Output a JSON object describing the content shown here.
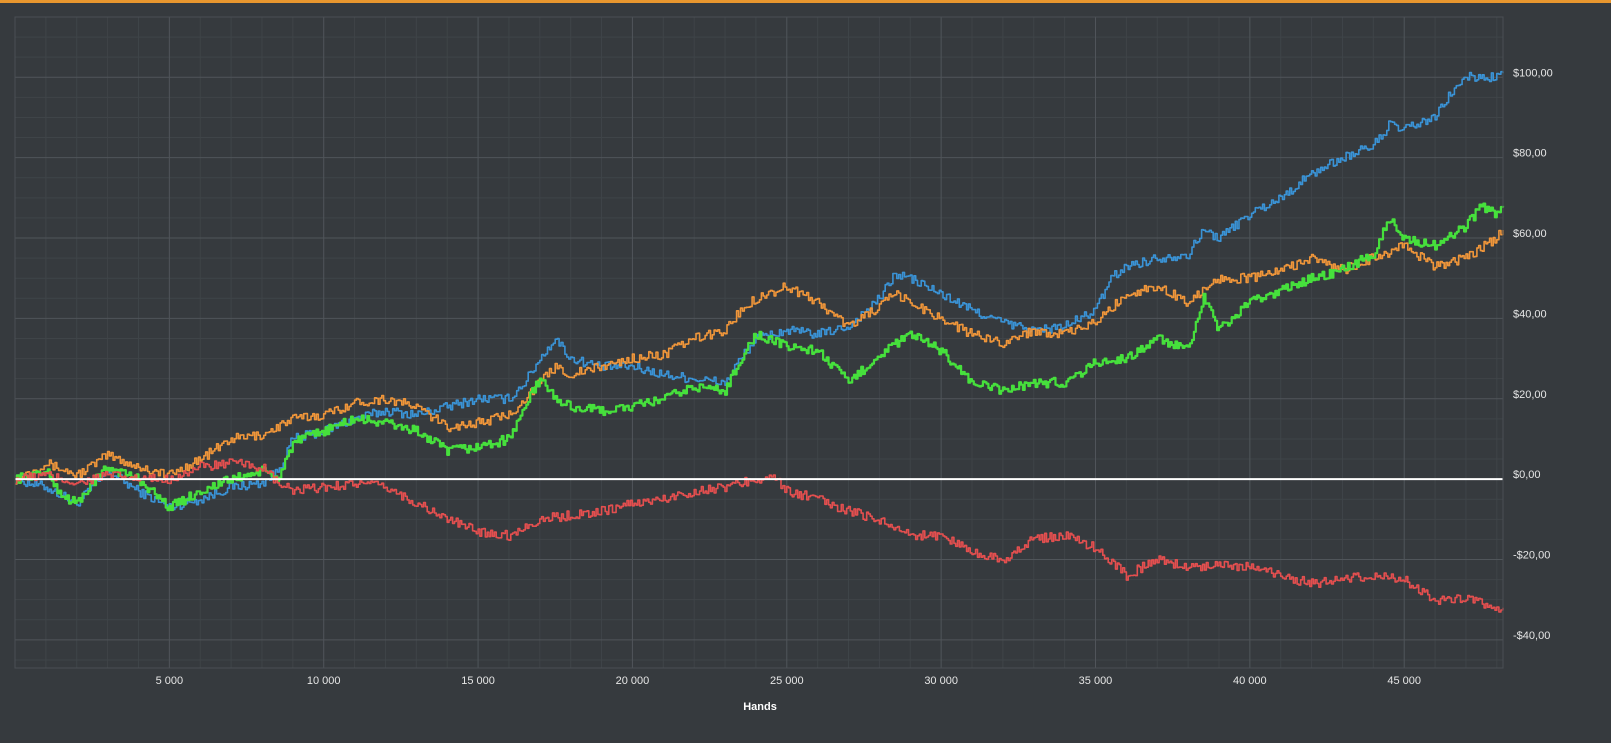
{
  "chart_data": {
    "type": "line",
    "title": "",
    "xlabel": "Hands",
    "ylabel": "",
    "xlim": [
      0,
      48200
    ],
    "ylim": [
      -47,
      115
    ],
    "x_ticks": [
      5000,
      10000,
      15000,
      20000,
      25000,
      30000,
      35000,
      40000,
      45000
    ],
    "x_tick_labels": [
      "5 000",
      "10 000",
      "15 000",
      "20 000",
      "25 000",
      "30 000",
      "35 000",
      "40 000",
      "45 000"
    ],
    "y_ticks": [
      100,
      80,
      60,
      40,
      20,
      0,
      -20,
      -40
    ],
    "y_tick_labels": [
      "$100,00",
      "$80,00",
      "$60,00",
      "$40,00",
      "$20,00",
      "$0,00",
      "-$20,00",
      "-$40,00"
    ],
    "grid": true,
    "legend": "none",
    "zero_line_color": "#ffffff",
    "series": [
      {
        "color": "#3a93d6",
        "points": [
          [
            0,
            0
          ],
          [
            1000,
            -2
          ],
          [
            2000,
            -6
          ],
          [
            3000,
            2
          ],
          [
            4000,
            -3
          ],
          [
            5000,
            -7
          ],
          [
            6000,
            -5
          ],
          [
            7000,
            -2
          ],
          [
            8000,
            -1
          ],
          [
            8500,
            2
          ],
          [
            9000,
            10
          ],
          [
            10000,
            12
          ],
          [
            11000,
            15
          ],
          [
            12000,
            17
          ],
          [
            13000,
            16
          ],
          [
            14000,
            18
          ],
          [
            15000,
            20
          ],
          [
            16000,
            20
          ],
          [
            16500,
            24
          ],
          [
            17000,
            30
          ],
          [
            17500,
            35
          ],
          [
            18000,
            30
          ],
          [
            19000,
            28
          ],
          [
            20000,
            28
          ],
          [
            21000,
            26
          ],
          [
            22000,
            25
          ],
          [
            23000,
            24
          ],
          [
            23500,
            30
          ],
          [
            24000,
            35
          ],
          [
            25000,
            37
          ],
          [
            26000,
            36
          ],
          [
            27000,
            38
          ],
          [
            28000,
            45
          ],
          [
            28500,
            51
          ],
          [
            29000,
            50
          ],
          [
            30000,
            46
          ],
          [
            31000,
            42
          ],
          [
            32000,
            39
          ],
          [
            33000,
            37
          ],
          [
            34000,
            38
          ],
          [
            35000,
            42
          ],
          [
            35500,
            50
          ],
          [
            36000,
            53
          ],
          [
            37000,
            55
          ],
          [
            38000,
            56
          ],
          [
            38500,
            62
          ],
          [
            39000,
            60
          ],
          [
            40000,
            66
          ],
          [
            41000,
            70
          ],
          [
            42000,
            76
          ],
          [
            43000,
            80
          ],
          [
            44000,
            83
          ],
          [
            44500,
            88
          ],
          [
            45000,
            87
          ],
          [
            46000,
            90
          ],
          [
            46500,
            96
          ],
          [
            47000,
            100
          ],
          [
            48000,
            100
          ],
          [
            48200,
            101
          ]
        ]
      },
      {
        "color": "#f0963a",
        "points": [
          [
            0,
            0
          ],
          [
            1000,
            4
          ],
          [
            2000,
            1
          ],
          [
            3000,
            6
          ],
          [
            4000,
            3
          ],
          [
            5000,
            1
          ],
          [
            6000,
            5
          ],
          [
            7000,
            10
          ],
          [
            8000,
            11
          ],
          [
            9000,
            15
          ],
          [
            10000,
            16
          ],
          [
            11000,
            19
          ],
          [
            12000,
            20
          ],
          [
            13000,
            18
          ],
          [
            14000,
            13
          ],
          [
            15000,
            14
          ],
          [
            16000,
            16
          ],
          [
            17000,
            24
          ],
          [
            17500,
            28
          ],
          [
            18000,
            26
          ],
          [
            19000,
            28
          ],
          [
            20000,
            30
          ],
          [
            21000,
            31
          ],
          [
            22000,
            35
          ],
          [
            23000,
            37
          ],
          [
            23500,
            42
          ],
          [
            24000,
            45
          ],
          [
            25000,
            48
          ],
          [
            26000,
            44
          ],
          [
            27000,
            38
          ],
          [
            28000,
            43
          ],
          [
            28500,
            46
          ],
          [
            29000,
            44
          ],
          [
            30000,
            40
          ],
          [
            31000,
            36
          ],
          [
            32000,
            34
          ],
          [
            33000,
            37
          ],
          [
            34000,
            36
          ],
          [
            35000,
            39
          ],
          [
            36000,
            46
          ],
          [
            37000,
            48
          ],
          [
            38000,
            44
          ],
          [
            39000,
            50
          ],
          [
            40000,
            50
          ],
          [
            41000,
            52
          ],
          [
            42000,
            55
          ],
          [
            43000,
            52
          ],
          [
            44000,
            55
          ],
          [
            45000,
            58
          ],
          [
            46000,
            53
          ],
          [
            47000,
            55
          ],
          [
            48000,
            60
          ],
          [
            48200,
            62
          ]
        ]
      },
      {
        "color": "#46e03c",
        "points": [
          [
            0,
            0
          ],
          [
            500,
            1
          ],
          [
            1000,
            2
          ],
          [
            1500,
            -4
          ],
          [
            2000,
            -6
          ],
          [
            2500,
            -1
          ],
          [
            3000,
            3
          ],
          [
            4000,
            0
          ],
          [
            5000,
            -7
          ],
          [
            6000,
            -3
          ],
          [
            7000,
            0
          ],
          [
            8000,
            2
          ],
          [
            8500,
            0
          ],
          [
            9000,
            9
          ],
          [
            10000,
            12
          ],
          [
            11000,
            15
          ],
          [
            12000,
            14
          ],
          [
            13000,
            12
          ],
          [
            14000,
            7
          ],
          [
            15000,
            8
          ],
          [
            16000,
            10
          ],
          [
            16500,
            18
          ],
          [
            17000,
            25
          ],
          [
            17500,
            20
          ],
          [
            18000,
            18
          ],
          [
            19000,
            17
          ],
          [
            20000,
            18
          ],
          [
            21000,
            20
          ],
          [
            22000,
            23
          ],
          [
            23000,
            22
          ],
          [
            23500,
            30
          ],
          [
            24000,
            36
          ],
          [
            25000,
            33
          ],
          [
            26000,
            32
          ],
          [
            27000,
            24
          ],
          [
            28000,
            31
          ],
          [
            29000,
            36
          ],
          [
            30000,
            32
          ],
          [
            31000,
            24
          ],
          [
            32000,
            22
          ],
          [
            33000,
            24
          ],
          [
            34000,
            24
          ],
          [
            35000,
            29
          ],
          [
            36000,
            30
          ],
          [
            37000,
            35
          ],
          [
            38000,
            32
          ],
          [
            38500,
            45
          ],
          [
            39000,
            37
          ],
          [
            40000,
            44
          ],
          [
            41000,
            47
          ],
          [
            42000,
            50
          ],
          [
            43000,
            52
          ],
          [
            44000,
            56
          ],
          [
            44500,
            65
          ],
          [
            45000,
            60
          ],
          [
            46000,
            58
          ],
          [
            47000,
            63
          ],
          [
            47500,
            68
          ],
          [
            48000,
            66
          ],
          [
            48200,
            68
          ]
        ]
      },
      {
        "color": "#e44f4f",
        "points": [
          [
            0,
            0
          ],
          [
            1000,
            1
          ],
          [
            2000,
            -1
          ],
          [
            3000,
            1
          ],
          [
            4000,
            0
          ],
          [
            5000,
            0
          ],
          [
            6000,
            3
          ],
          [
            7000,
            4
          ],
          [
            8000,
            3
          ],
          [
            8500,
            -1
          ],
          [
            9000,
            -3
          ],
          [
            10000,
            -2
          ],
          [
            11000,
            -1
          ],
          [
            12000,
            -2
          ],
          [
            13000,
            -6
          ],
          [
            14000,
            -10
          ],
          [
            15000,
            -13
          ],
          [
            16000,
            -14
          ],
          [
            17000,
            -10
          ],
          [
            18000,
            -9
          ],
          [
            19000,
            -8
          ],
          [
            20000,
            -6
          ],
          [
            21000,
            -5
          ],
          [
            22000,
            -3
          ],
          [
            23000,
            -2
          ],
          [
            24000,
            0
          ],
          [
            24500,
            1
          ],
          [
            25000,
            -3
          ],
          [
            26000,
            -5
          ],
          [
            27000,
            -8
          ],
          [
            28000,
            -10
          ],
          [
            29000,
            -14
          ],
          [
            30000,
            -14
          ],
          [
            31000,
            -18
          ],
          [
            32000,
            -20
          ],
          [
            33000,
            -15
          ],
          [
            34000,
            -14
          ],
          [
            35000,
            -17
          ],
          [
            36000,
            -24
          ],
          [
            37000,
            -20
          ],
          [
            38000,
            -22
          ],
          [
            39000,
            -21
          ],
          [
            40000,
            -22
          ],
          [
            41000,
            -24
          ],
          [
            42000,
            -26
          ],
          [
            43000,
            -25
          ],
          [
            44000,
            -24
          ],
          [
            45000,
            -25
          ],
          [
            46000,
            -30
          ],
          [
            47000,
            -30
          ],
          [
            48000,
            -32
          ],
          [
            48200,
            -32
          ]
        ]
      }
    ]
  }
}
